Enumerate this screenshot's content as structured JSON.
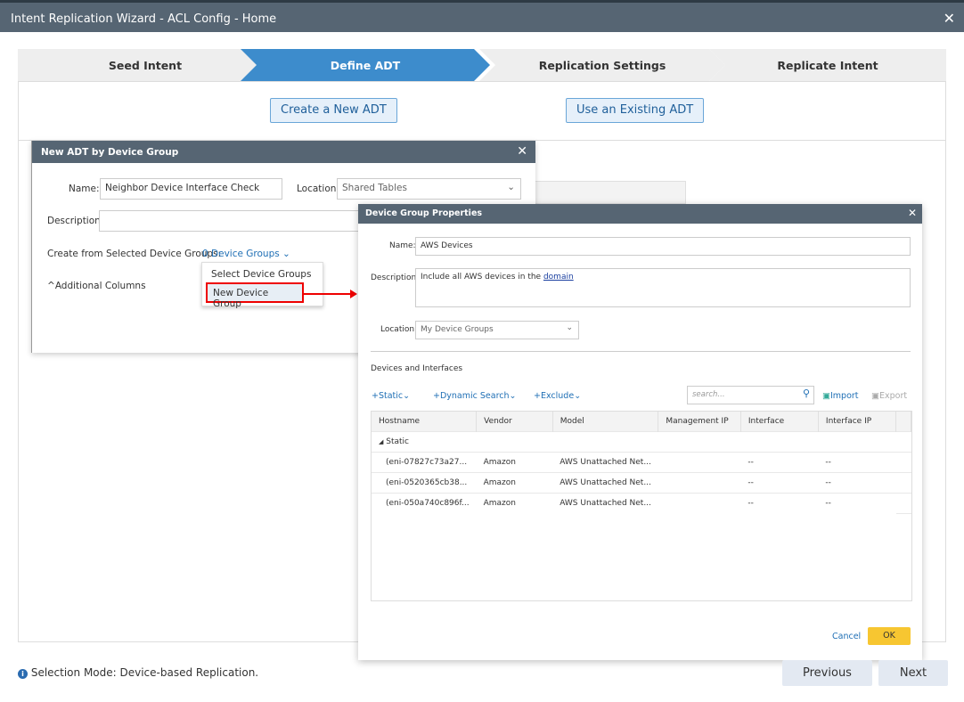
{
  "window": {
    "title": "Intent Replication Wizard - ACL Config - Home",
    "close": "✕"
  },
  "steps": [
    "Seed Intent",
    "Define ADT",
    "Replication Settings",
    "Replicate Intent"
  ],
  "actions": {
    "create_new": "Create a New ADT",
    "use_existing": "Use an Existing ADT"
  },
  "adt_dialog": {
    "title": "New ADT by Device Group",
    "close": "✕",
    "name_label": "Name:",
    "name_value": "Neighbor Device Interface Check",
    "location_label": "Location:",
    "location_value": "Shared Tables",
    "description_label": "Description:",
    "description_value": "",
    "create_from_label": "Create from Selected Device Groups:",
    "device_groups_link": "0 Device Groups",
    "additional_columns": "Additional Columns",
    "menu": [
      "Select Device Groups",
      "New Device Group"
    ]
  },
  "dg_dialog": {
    "title": "Device Group Properties",
    "close": "✕",
    "name_label": "Name:",
    "name_value": "AWS Devices",
    "description_label": "Description:",
    "description_prefix": "Include all AWS devices in the ",
    "description_link": "domain",
    "location_label": "Location:",
    "location_value": "My Device Groups",
    "section": "Devices and Interfaces",
    "toolbar": {
      "static": "Static",
      "dynamic": "Dynamic Search",
      "exclude": "Exclude",
      "search_placeholder": "search...",
      "import": "Import",
      "export": "Export"
    },
    "columns": [
      "Hostname",
      "Vendor",
      "Model",
      "Management IP",
      "Interface",
      "Interface IP"
    ],
    "group": "Static",
    "rows": [
      [
        "(eni-07827c73a27...",
        "Amazon",
        "AWS Unattached Net...",
        "",
        "--",
        "--"
      ],
      [
        "(eni-0520365cb38...",
        "Amazon",
        "AWS Unattached Net...",
        "",
        "--",
        "--"
      ],
      [
        "(eni-050a740c896f...",
        "Amazon",
        "AWS Unattached Net...",
        "",
        "--",
        "--"
      ]
    ],
    "cancel": "Cancel",
    "ok": "OK"
  },
  "footer": {
    "status": "Selection Mode: Device-based Replication.",
    "previous": "Previous",
    "next": "Next"
  }
}
